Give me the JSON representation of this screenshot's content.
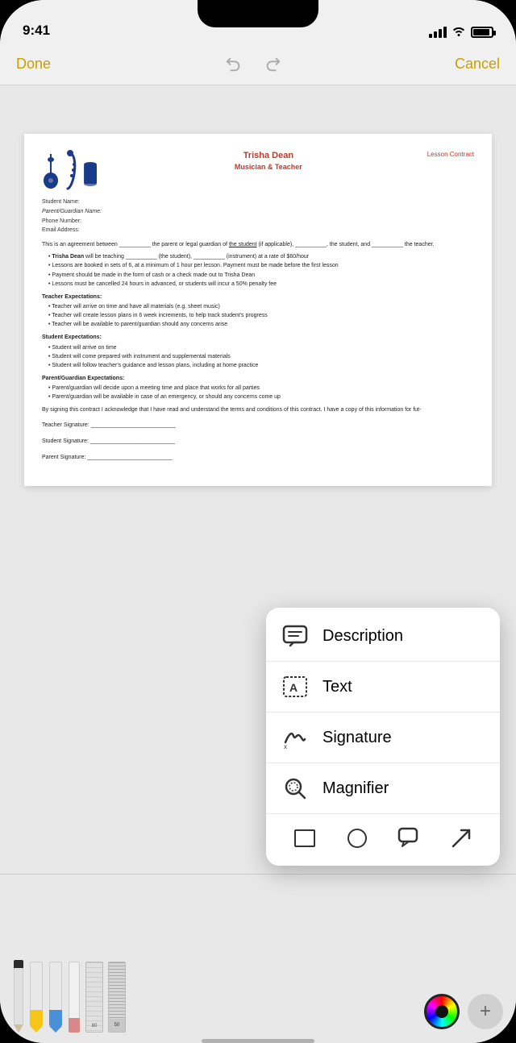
{
  "status": {
    "time": "9:41",
    "signal_bars": [
      5,
      8,
      11,
      14
    ],
    "battery_level": "90%"
  },
  "toolbar": {
    "done_label": "Done",
    "cancel_label": "Cancel",
    "undo_icon": "undo",
    "redo_icon": "redo"
  },
  "document": {
    "person_name": "Trisha Dean",
    "person_title": "Musician & Teacher",
    "contract_label": "Lesson Contract",
    "fields": [
      {
        "label": "Student Name:"
      },
      {
        "label": "Parent/Guardian Name:",
        "italic": true
      },
      {
        "label": "Phone Number:"
      },
      {
        "label": "Email Address:"
      }
    ],
    "agreement_text": "This is an agreement between __________ the parent or legal guardian of the student (if applicable), __________, the student, and __________ the teacher.",
    "bullet_points": [
      "Trisha Dean will be teaching __________ (the student), __________ (instrument) at a rate of $60/hour",
      "Lessons are booked in sets of 6, at a minimum of 1 hour per lesson. Payment must be made before the first lesson",
      "Payment should be made in the form of cash or a check made out to Trisha Dean",
      "Lessons must be cancelled 24 hours in advanced, or students will incur a 50% penalty fee"
    ],
    "sections": [
      {
        "title": "Teacher Expectations:",
        "bullets": [
          "Teacher will arrive on time and have all materials (e.g. sheet music)",
          "Teacher will create lesson plans in 6 week increments, to help track student's progress",
          "Teacher will be available to parent/guardian should any concerns arise"
        ]
      },
      {
        "title": "Student Expectations:",
        "bullets": [
          "Student will arrive on time",
          "Student will come prepared with instrument and supplemental materials",
          "Student will follow teacher's guidance and lesson plans, including at home practice"
        ]
      },
      {
        "title": "Parent/Guardian Expectations:",
        "bullets": [
          "Parent/guardian will decide upon a meeting time and place that works for all parties",
          "Parent/guardian will be available in case of an emergency, or should any concerns come up"
        ]
      }
    ],
    "closing_text": "By signing this contract I acknowledge that I have read and understand the terms and conditions of this contract. I have a copy of this information for fut-",
    "signatures": [
      "Teacher Signature: ___________________________",
      "Student Signature: ___________________________",
      "Parent Signature: ___________________________"
    ]
  },
  "popup_menu": {
    "items": [
      {
        "id": "description",
        "label": "Description",
        "icon": "speech-bubble"
      },
      {
        "id": "text",
        "label": "Text",
        "icon": "text-box"
      },
      {
        "id": "signature",
        "label": "Signature",
        "icon": "signature"
      },
      {
        "id": "magnifier",
        "label": "Magnifier",
        "icon": "magnifier"
      }
    ],
    "shapes": [
      "rectangle",
      "circle",
      "speech",
      "arrow"
    ]
  },
  "drawing_tools": {
    "ruler_number": "80",
    "tape_number": "50"
  }
}
